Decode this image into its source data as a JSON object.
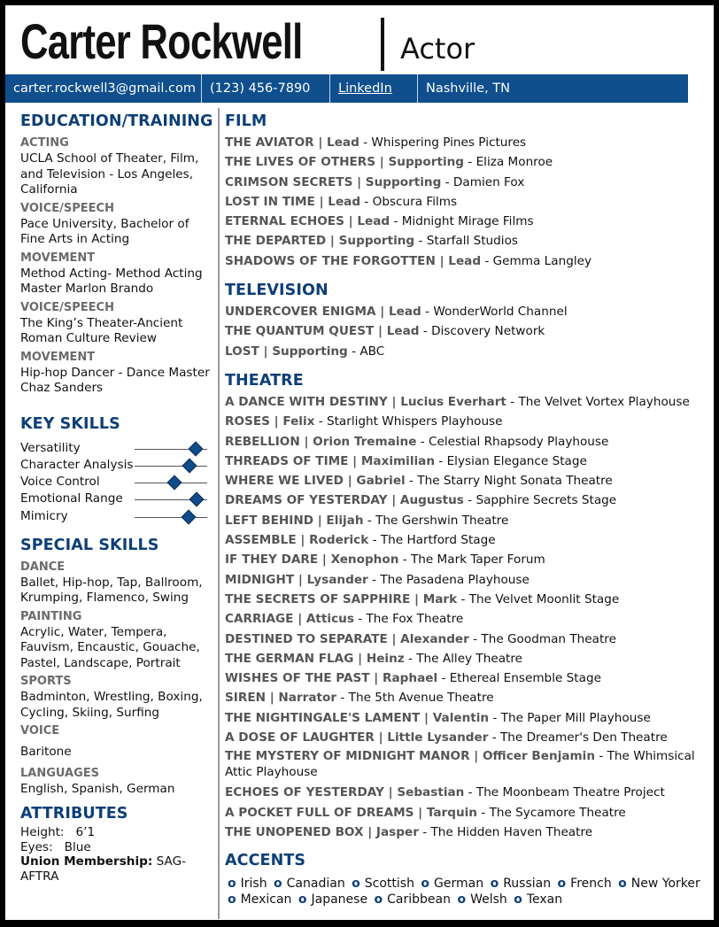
{
  "header": {
    "name": "Carter Rockwell",
    "title": "Actor"
  },
  "contact": {
    "email": "carter.rockwell3@gmail.com",
    "phone": "(123) 456-7890",
    "linkedin": "LinkedIn",
    "location": "Nashville, TN"
  },
  "colors": {
    "accent": "#0d3f78",
    "bar": "#0f4f8e",
    "muted": "#555555"
  },
  "education": {
    "heading": "EDUCATION/TRAINING",
    "items": [
      {
        "category": "ACTING",
        "text": "UCLA School of Theater, Film, and Television - Los Angeles, California"
      },
      {
        "category": "VOICE/SPEECH",
        "text": "Pace University, Bachelor of Fine Arts in Acting"
      },
      {
        "category": "MOVEMENT",
        "text": "Method Acting- Method Acting Master Marlon Brando"
      },
      {
        "category": "VOICE/SPEECH",
        "text": "The King’s Theater-Ancient Roman Culture Review"
      },
      {
        "category": "MOVEMENT",
        "text": "Hip-hop Dancer - Dance Master Chaz Sanders"
      }
    ]
  },
  "key_skills": {
    "heading": "KEY SKILLS",
    "items": [
      {
        "label": "Versatility",
        "level": 0.84
      },
      {
        "label": "Character Analysis",
        "level": 0.75
      },
      {
        "label": "Voice Control",
        "level": 0.55
      },
      {
        "label": "Emotional Range",
        "level": 0.85
      },
      {
        "label": "Mimicry",
        "level": 0.74
      }
    ]
  },
  "special_skills": {
    "heading": "SPECIAL SKILLS",
    "items": [
      {
        "category": "DANCE",
        "text": "Ballet, Hip-hop, Tap, Ballroom, Krumping, Flamenco, Swing"
      },
      {
        "category": "PAINTING",
        "text": "Acrylic, Water, Tempera, Fauvism, Encaustic, Gouache, Pastel, Landscape, Portrait"
      },
      {
        "category": "SPORTS",
        "text": "Badminton, Wrestling, Boxing, Cycling, Skiing, Surfing"
      },
      {
        "category": "VOICE",
        "text": "Baritone"
      },
      {
        "category": "LANGUAGES",
        "text": "English, Spanish, German"
      }
    ]
  },
  "attributes": {
    "heading": "ATTRIBUTES",
    "height_label": "Height:",
    "height_value": "6’1",
    "eyes_label": "Eyes:",
    "eyes_value": "Blue",
    "union_label": "Union Membership:",
    "union_value": "SAG-AFTRA"
  },
  "film": {
    "heading": "FILM",
    "credits": [
      {
        "title": "THE AVIATOR",
        "role": "Lead",
        "company": "Whispering Pines Pictures"
      },
      {
        "title": "THE LIVES OF OTHERS",
        "role": "Supporting",
        "company": "Eliza Monroe"
      },
      {
        "title": "CRIMSON SECRETS",
        "role": "Supporting",
        "company": "Damien Fox"
      },
      {
        "title": "LOST IN TIME",
        "role": "Lead",
        "company": "Obscura Films"
      },
      {
        "title": "ETERNAL ECHOES",
        "role": "Lead",
        "company": "Midnight Mirage Films"
      },
      {
        "title": "THE DEPARTED",
        "role": "Supporting",
        "company": "Starfall Studios"
      },
      {
        "title": "SHADOWS OF THE FORGOTTEN",
        "role": "Lead",
        "company": "Gemma Langley"
      }
    ]
  },
  "television": {
    "heading": "TELEVISION",
    "credits": [
      {
        "title": "UNDERCOVER ENIGMA",
        "role": "Lead",
        "company": "WonderWorld Channel"
      },
      {
        "title": "THE QUANTUM QUEST",
        "role": "Lead",
        "company": "Discovery Network"
      },
      {
        "title": "LOST",
        "role": "Supporting",
        "company": "ABC"
      }
    ]
  },
  "theatre": {
    "heading": "THEATRE",
    "credits": [
      {
        "title": "A DANCE WITH DESTINY",
        "role": "Lucius Everhart",
        "company": "The Velvet Vortex Playhouse"
      },
      {
        "title": "ROSES",
        "role": "Felix",
        "company": "Starlight Whispers Playhouse"
      },
      {
        "title": "REBELLION",
        "role": "Orion Tremaine",
        "company": "Celestial Rhapsody Playhouse"
      },
      {
        "title": "THREADS OF TIME",
        "role": "Maximilian",
        "company": "Elysian Elegance Stage"
      },
      {
        "title": "WHERE WE LIVED",
        "role": "Gabriel",
        "company": "The Starry Night Sonata Theatre"
      },
      {
        "title": "DREAMS OF YESTERDAY",
        "role": "Augustus",
        "company": "Sapphire Secrets Stage"
      },
      {
        "title": "LEFT BEHIND",
        "role": "Elijah",
        "company": "The Gershwin Theatre"
      },
      {
        "title": "ASSEMBLE",
        "role": "Roderick",
        "company": "The Hartford Stage"
      },
      {
        "title": "IF THEY DARE",
        "role": "Xenophon",
        "company": "The Mark Taper Forum"
      },
      {
        "title": "MIDNIGHT",
        "role": "Lysander",
        "company": "The Pasadena Playhouse"
      },
      {
        "title": "THE SECRETS OF SAPPHIRE",
        "role": "Mark",
        "company": "The Velvet Moonlit Stage"
      },
      {
        "title": "CARRIAGE",
        "role": "Atticus",
        "company": "The Fox Theatre"
      },
      {
        "title": "DESTINED TO SEPARATE",
        "role": "Alexander",
        "company": "The Goodman Theatre"
      },
      {
        "title": "THE GERMAN FLAG",
        "role": "Heinz",
        "company": "The Alley Theatre"
      },
      {
        "title": "WISHES OF THE PAST",
        "role": "Raphael",
        "company": "Ethereal Ensemble Stage"
      },
      {
        "title": "SIREN",
        "role": "Narrator",
        "company": "The 5th Avenue Theatre"
      },
      {
        "title": "THE NIGHTINGALE'S LAMENT",
        "role": "Valentin",
        "company": "The Paper Mill Playhouse"
      },
      {
        "title": "A DOSE OF LAUGHTER",
        "role": "Little Lysander",
        "company": "The Dreamer's Den Theatre"
      },
      {
        "title": "THE MYSTERY OF MIDNIGHT MANOR",
        "role": "Officer Benjamin",
        "company": "The Whimsical Attic Playhouse"
      },
      {
        "title": "ECHOES OF YESTERDAY",
        "role": "Sebastian",
        "company": "The Moonbeam Theatre Project"
      },
      {
        "title": "A POCKET FULL OF DREAMS",
        "role": "Tarquin",
        "company": "The Sycamore Theatre"
      },
      {
        "title": "THE UNOPENED BOX",
        "role": "Jasper",
        "company": "The Hidden Haven Theatre"
      }
    ]
  },
  "accents": {
    "heading": "ACCENTS",
    "bullet": "o",
    "items": [
      "Irish",
      "Canadian",
      "Scottish",
      "German",
      "Russian",
      "French",
      "New Yorker",
      "Mexican",
      "Japanese",
      "Caribbean",
      "Welsh",
      "Texan"
    ]
  }
}
